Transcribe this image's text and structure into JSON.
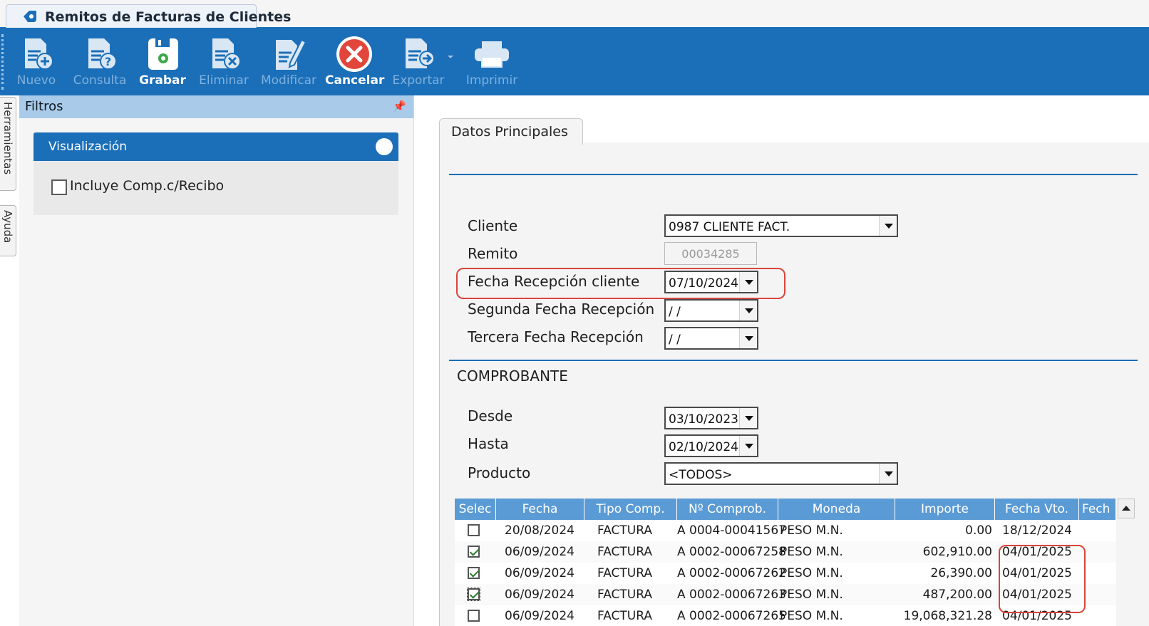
{
  "window": {
    "tab_title": "Remitos de Facturas de Clientes"
  },
  "toolbar": {
    "buttons": [
      {
        "label": "Nuevo",
        "icon": "doc-plus-icon",
        "enabled": false
      },
      {
        "label": "Consulta",
        "icon": "doc-question-icon",
        "enabled": false
      },
      {
        "label": "Grabar",
        "icon": "save-icon",
        "enabled": true
      },
      {
        "label": "Eliminar",
        "icon": "doc-delete-icon",
        "enabled": false
      },
      {
        "label": "Modificar",
        "icon": "doc-edit-icon",
        "enabled": false
      },
      {
        "label": "Cancelar",
        "icon": "cancel-icon",
        "enabled": true
      },
      {
        "label": "Exportar",
        "icon": "doc-export-icon",
        "enabled": false
      },
      {
        "label": "Imprimir",
        "icon": "printer-icon",
        "enabled": false
      }
    ]
  },
  "side_tabs": {
    "herramientas": "Herramientas",
    "ayuda": "Ayuda"
  },
  "filters": {
    "title": "Filtros",
    "group_title": "Visualización",
    "include_label": "Incluye Comp.c/Recibo",
    "include_checked": false
  },
  "form": {
    "tab_label": "Datos Principales",
    "cliente": {
      "label": "Cliente",
      "value": "0987 CLIENTE FACT."
    },
    "remito": {
      "label": "Remito",
      "value": "00034285"
    },
    "fecha_recepcion": {
      "label": "Fecha Recepción cliente",
      "value": "07/10/2024"
    },
    "segunda_fecha": {
      "label": "Segunda Fecha Recepción",
      "value": " /  /"
    },
    "tercera_fecha": {
      "label": "Tercera Fecha Recepción",
      "value": " /  /"
    },
    "comprobante_title": "COMPROBANTE",
    "desde": {
      "label": "Desde",
      "value": "03/10/2023"
    },
    "hasta": {
      "label": "Hasta",
      "value": "02/10/2024"
    },
    "producto": {
      "label": "Producto",
      "value": "<TODOS>"
    }
  },
  "grid": {
    "columns": [
      "Selec",
      "Fecha",
      "Tipo Comp.",
      "Nº Comprob.",
      "Moneda",
      "Importe",
      "Fecha Vto.",
      "Fech"
    ],
    "rows": [
      {
        "selected": false,
        "fecha": "20/08/2024",
        "tipo": "FACTURA",
        "comprob": "A 0004-00041567",
        "moneda": "PESO M.N.",
        "importe": "0.00",
        "vto": "18/12/2024"
      },
      {
        "selected": true,
        "fecha": "06/09/2024",
        "tipo": "FACTURA",
        "comprob": "A 0002-00067258",
        "moneda": "PESO M.N.",
        "importe": "602,910.00",
        "vto": "04/01/2025"
      },
      {
        "selected": true,
        "fecha": "06/09/2024",
        "tipo": "FACTURA",
        "comprob": "A 0002-00067262",
        "moneda": "PESO M.N.",
        "importe": "26,390.00",
        "vto": "04/01/2025"
      },
      {
        "selected": true,
        "fecha": "06/09/2024",
        "tipo": "FACTURA",
        "comprob": "A 0002-00067263",
        "moneda": "PESO M.N.",
        "importe": "487,200.00",
        "vto": "04/01/2025"
      },
      {
        "selected": false,
        "fecha": "06/09/2024",
        "tipo": "FACTURA",
        "comprob": "A 0002-00067265",
        "moneda": "PESO M.N.",
        "importe": "19,068,321.28",
        "vto": "04/01/2025"
      }
    ]
  },
  "colors": {
    "toolbar_blue": "#1b6fb8",
    "highlight_red": "#d9453b",
    "grid_header": "#5b9bd5",
    "cancel_red": "#e2453a"
  }
}
